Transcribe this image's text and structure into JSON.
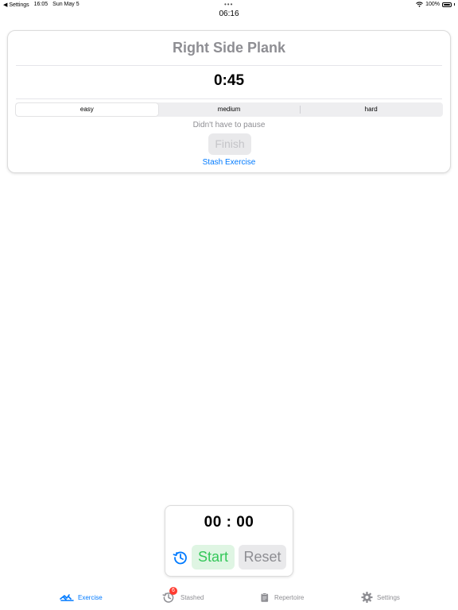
{
  "status_bar": {
    "back_label": "◀ Settings",
    "time": "16:05",
    "date": "Sun May 5",
    "multitask_dots": "•••",
    "battery": "100%"
  },
  "clock": "06:16",
  "exercise": {
    "title": "Right Side Plank",
    "duration": "0:45",
    "difficulty": {
      "options": [
        "easy",
        "medium",
        "hard"
      ],
      "selected": "easy"
    },
    "pause_text": "Didn't have to pause",
    "finish_label": "Finish",
    "stash_label": "Stash Exercise"
  },
  "timer": {
    "display": "00 : 00",
    "start_label": "Start",
    "reset_label": "Reset"
  },
  "tab_bar": {
    "tabs": [
      {
        "label": "Exercise",
        "icon": "exercise-icon",
        "active": true
      },
      {
        "label": "Stashed",
        "icon": "history-icon",
        "badge": "6"
      },
      {
        "label": "Repertoire",
        "icon": "clipboard-icon"
      },
      {
        "label": "Settings",
        "icon": "gear-icon"
      }
    ]
  },
  "colors": {
    "accent": "#007aff",
    "start_green": "#34c759",
    "badge_red": "#ff3b30",
    "muted_gray": "#8e8e93"
  }
}
